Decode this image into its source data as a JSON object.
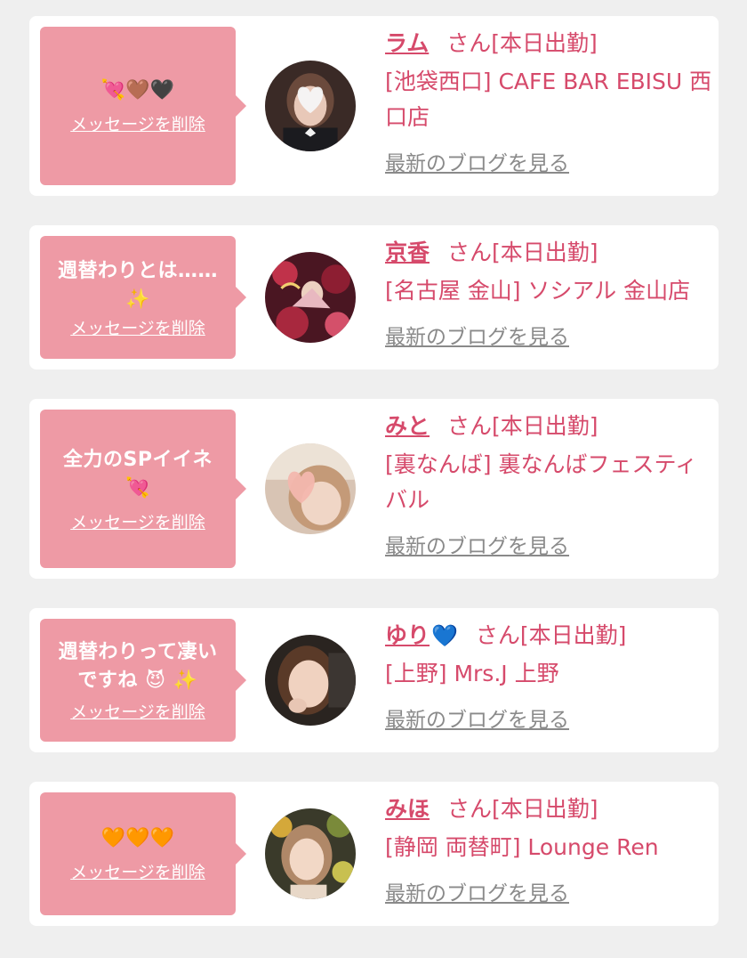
{
  "theme": {
    "accent": "#d64a6b",
    "bubble": "#ee9aa5",
    "link_gray": "#8a8a8a",
    "heart_blue": "#1a2ad8"
  },
  "items": [
    {
      "message": "",
      "emoji": "💘🤎🖤",
      "delete_label": "メッセージを削除",
      "name": "ラム",
      "name_suffix": "さん[本日出勤]",
      "shop": "[池袋西口] CAFE BAR EBISU 西口店",
      "blog_label": "最新のブログを見る",
      "avatar_icon": "photo-avatar-heart-sticker"
    },
    {
      "message": "週替わりとは……",
      "emoji": "✨",
      "delete_label": "メッセージを削除",
      "name": "京香",
      "name_suffix": "さん[本日出勤]",
      "shop": "[名古屋 金山] ソシアル 金山店",
      "blog_label": "最新のブログを見る",
      "avatar_icon": "photo-avatar-kimono-fan"
    },
    {
      "message": "全力のSPイイネ",
      "emoji": "💘",
      "delete_label": "メッセージを削除",
      "name": "みと",
      "name_suffix": "さん[本日出勤]",
      "shop": "[裏なんば] 裏なんばフェスティバル",
      "blog_label": "最新のブログを見る",
      "avatar_icon": "photo-avatar-heart-sticker"
    },
    {
      "message": "週替わりって凄いですね",
      "emoji": "😈 ✨",
      "delete_label": "メッセージを削除",
      "name": "ゆり",
      "name_heart": "💙",
      "name_suffix": "さん[本日出勤]",
      "shop": "[上野] Mrs.J 上野",
      "blog_label": "最新のブログを見る",
      "avatar_icon": "photo-avatar-portrait"
    },
    {
      "message": "",
      "emoji": "🧡🧡🧡",
      "delete_label": "メッセージを削除",
      "name": "みほ",
      "name_suffix": "さん[本日出勤]",
      "shop": "[静岡 両替町] Lounge Ren",
      "blog_label": "最新のブログを見る",
      "avatar_icon": "photo-avatar-flowers"
    }
  ]
}
